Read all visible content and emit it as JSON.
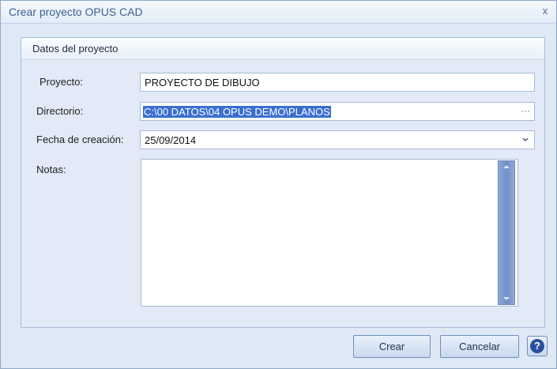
{
  "window": {
    "title": "Crear proyecto OPUS CAD",
    "close_glyph": "x"
  },
  "group": {
    "title": "Datos del proyecto"
  },
  "form": {
    "proyecto_label": "Proyecto:",
    "proyecto_value": "PROYECTO DE DIBUJO",
    "directorio_label": "Directorio:",
    "directorio_value": "C:\\00 DATOS\\04 OPUS DEMO\\PLANOS",
    "directorio_button": "···",
    "fecha_label": "Fecha de creación:",
    "fecha_value": "25/09/2014",
    "notas_label": "Notas:",
    "notas_value": ""
  },
  "buttons": {
    "crear": "Crear",
    "cancelar": "Cancelar",
    "help": "?"
  },
  "icons": {
    "close": "close-icon",
    "browse": "ellipsis-icon",
    "dropdown": "chevron-down-icon",
    "help": "help-icon"
  },
  "colors": {
    "title_text": "#3d5f8f",
    "selection": "#3a6fd1",
    "scrollbar": "#6f8fc8",
    "help_icon": "#2a4f9c"
  }
}
